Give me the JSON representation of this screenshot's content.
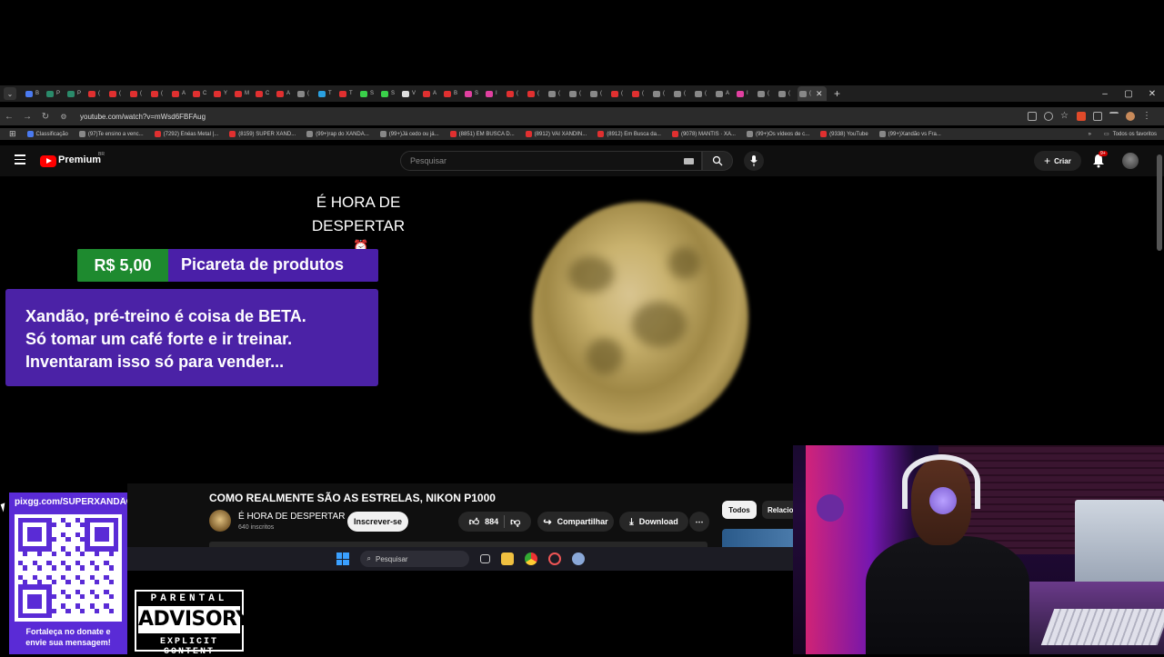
{
  "browser": {
    "url": "youtube.com/watch?v=mWsd6FBFAug",
    "tabs": [
      {
        "t": "B",
        "c": "#4a7af0"
      },
      {
        "t": "P",
        "c": "#2a8a6a"
      },
      {
        "t": "P",
        "c": "#2a8a6a"
      },
      {
        "t": "(",
        "c": "#e03030"
      },
      {
        "t": "(",
        "c": "#e03030"
      },
      {
        "t": "(",
        "c": "#e03030"
      },
      {
        "t": "(",
        "c": "#e03030"
      },
      {
        "t": "A",
        "c": "#e03030"
      },
      {
        "t": "C",
        "c": "#e03030"
      },
      {
        "t": "Y",
        "c": "#e03030"
      },
      {
        "t": "M",
        "c": "#e03030"
      },
      {
        "t": "C",
        "c": "#e03030"
      },
      {
        "t": "A",
        "c": "#e03030"
      },
      {
        "t": "(",
        "c": "#888"
      },
      {
        "t": "T",
        "c": "#2aa0e0"
      },
      {
        "t": "T",
        "c": "#e03030"
      },
      {
        "t": "S",
        "c": "#3ad04a"
      },
      {
        "t": "S",
        "c": "#3ad04a"
      },
      {
        "t": "V",
        "c": "#ddd"
      },
      {
        "t": "A",
        "c": "#e03030"
      },
      {
        "t": "B",
        "c": "#e03030"
      },
      {
        "t": "S",
        "c": "#e040a0"
      },
      {
        "t": "I",
        "c": "#e040a0"
      },
      {
        "t": "(",
        "c": "#e03030"
      },
      {
        "t": "(",
        "c": "#e03030"
      },
      {
        "t": "(",
        "c": "#888"
      },
      {
        "t": "(",
        "c": "#888"
      },
      {
        "t": "(",
        "c": "#888"
      },
      {
        "t": "(",
        "c": "#e03030"
      },
      {
        "t": "(",
        "c": "#e03030"
      },
      {
        "t": "(",
        "c": "#888"
      },
      {
        "t": "(",
        "c": "#888"
      },
      {
        "t": "(",
        "c": "#888"
      },
      {
        "t": "A",
        "c": "#888"
      },
      {
        "t": "I",
        "c": "#e040a0"
      },
      {
        "t": "(",
        "c": "#888"
      },
      {
        "t": "(",
        "c": "#888"
      },
      {
        "t": "(",
        "c": "#888"
      }
    ],
    "bookmarks": [
      {
        "label": "Classificação",
        "c": "#4a7af0"
      },
      {
        "label": "(97)Te ensino a venc...",
        "c": "#888"
      },
      {
        "label": "(7292) Enéas Metal |...",
        "c": "#e03030"
      },
      {
        "label": "(8159) SUPER XAND...",
        "c": "#e03030"
      },
      {
        "label": "(99+)rap do XANDÃ...",
        "c": "#888"
      },
      {
        "label": "(99+)Já cedo ou já...",
        "c": "#888"
      },
      {
        "label": "(8851) EM BUSCA D...",
        "c": "#e03030"
      },
      {
        "label": "(8912) VAI XANDIN...",
        "c": "#e03030"
      },
      {
        "label": "(8912) Em Busca da...",
        "c": "#e03030"
      },
      {
        "label": "(9078) MANTIS · XA...",
        "c": "#e03030"
      },
      {
        "label": "(99+)Os vídeos de c...",
        "c": "#888"
      },
      {
        "label": "(9338) YouTube",
        "c": "#e03030"
      },
      {
        "label": "(99+)Xandão vs Fra...",
        "c": "#888"
      }
    ],
    "all_bookmarks": "Todos os favoritos"
  },
  "youtube": {
    "brand": "Premium",
    "region": "BR",
    "search_placeholder": "Pesquisar",
    "create_label": "Criar",
    "notif_badge": "9+"
  },
  "overlay": {
    "alarm_text_1": "É HORA DE",
    "alarm_text_2": "DESPERTAR",
    "donation_amount": "R$ 5,00",
    "donation_name": "Picareta de produtos",
    "donation_lines": [
      "Xandão, pré-treino é coisa de BETA.",
      "Só tomar um café forte e ir treinar.",
      "Inventaram isso só para vender..."
    ]
  },
  "video": {
    "title": "COMO REALMENTE SÃO AS ESTRELAS, NIKON P1000",
    "channel": "É HORA DE DESPERTAR",
    "subscribers": "640 inscritos",
    "subscribe_label": "Inscrever-se",
    "likes": "884",
    "share_label": "Compartilhar",
    "download_label": "Download",
    "chip_all": "Todos",
    "chip_related": "Relacionados"
  },
  "taskbar": {
    "search_label": "Pesquisar"
  },
  "stream": {
    "qr_url": "pixgg.com/SUPERXANDÃO",
    "qr_caption_1": "Fortaleça no donate e",
    "qr_caption_2": "envie sua mensagem!",
    "pa_top": "PARENTAL",
    "pa_mid": "ADVISORY",
    "pa_bot": "EXPLICIT CONTENT"
  }
}
